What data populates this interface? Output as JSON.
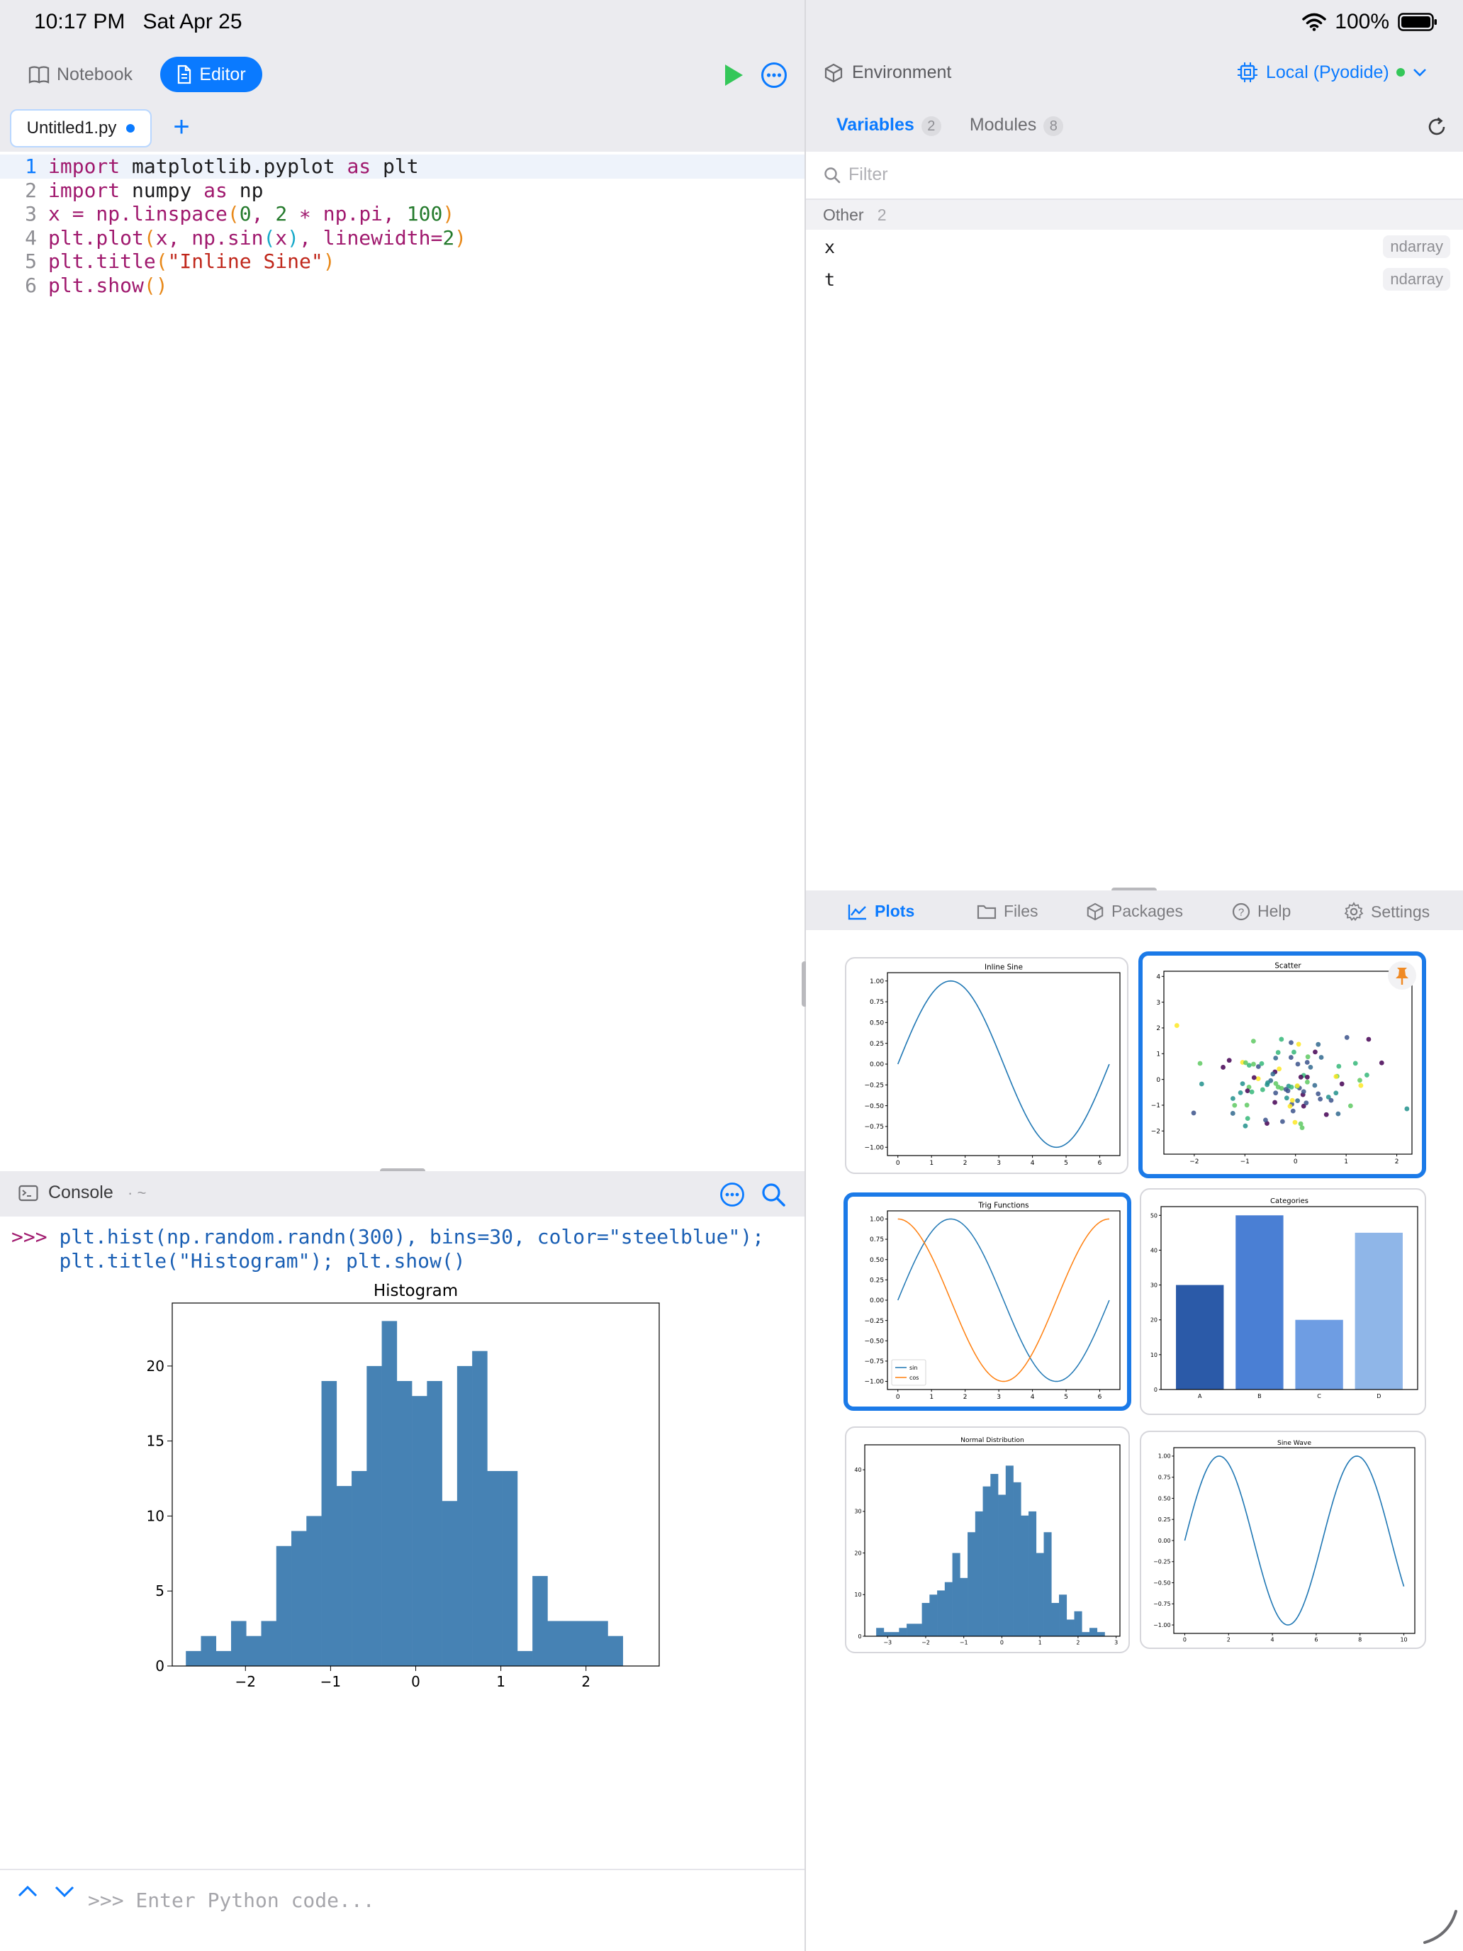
{
  "status": {
    "time": "10:17 PM",
    "date": "Sat Apr 25",
    "battery": "100%"
  },
  "left_toolbar": {
    "notebook_label": "Notebook",
    "editor_label": "Editor"
  },
  "editor": {
    "tab_name": "Untitled1.py",
    "lines": [
      {
        "n": "1",
        "segments": [
          {
            "c": "kw",
            "t": "import"
          },
          {
            "c": "",
            "t": " matplotlib.pyplot "
          },
          {
            "c": "kw",
            "t": "as"
          },
          {
            "c": "",
            "t": " plt"
          }
        ]
      },
      {
        "n": "2",
        "segments": [
          {
            "c": "kw",
            "t": "import"
          },
          {
            "c": "",
            "t": " numpy "
          },
          {
            "c": "kw",
            "t": "as"
          },
          {
            "c": "",
            "t": " np"
          }
        ]
      },
      {
        "n": "3",
        "segments": [
          {
            "c": "kw",
            "t": "x = np.linspace"
          },
          {
            "c": "par",
            "t": "("
          },
          {
            "c": "num",
            "t": "0"
          },
          {
            "c": "kw",
            "t": ", "
          },
          {
            "c": "num",
            "t": "2"
          },
          {
            "c": "kw",
            "t": " ∗ np.pi, "
          },
          {
            "c": "num",
            "t": "100"
          },
          {
            "c": "par",
            "t": ")"
          }
        ]
      },
      {
        "n": "4",
        "segments": [
          {
            "c": "kw",
            "t": "plt.plot"
          },
          {
            "c": "par",
            "t": "("
          },
          {
            "c": "kw",
            "t": "x, np.sin"
          },
          {
            "c": "par2",
            "t": "("
          },
          {
            "c": "kw",
            "t": "x"
          },
          {
            "c": "par2",
            "t": ")"
          },
          {
            "c": "kw",
            "t": ", linewidth="
          },
          {
            "c": "num",
            "t": "2"
          },
          {
            "c": "par",
            "t": ")"
          }
        ]
      },
      {
        "n": "5",
        "segments": [
          {
            "c": "kw",
            "t": "plt.title"
          },
          {
            "c": "par",
            "t": "("
          },
          {
            "c": "str",
            "t": "\"Inline Sine\""
          },
          {
            "c": "par",
            "t": ")"
          }
        ]
      },
      {
        "n": "6",
        "segments": [
          {
            "c": "kw",
            "t": "plt.show"
          },
          {
            "c": "par",
            "t": "()"
          }
        ]
      }
    ]
  },
  "console": {
    "title": "Console",
    "subtitle": "· ~",
    "prompt": ">>>",
    "command_line1": "plt.hist(np.random.randn(300), bins=30, color=\"steelblue\");",
    "command_line2": "plt.title(\"Histogram\"); plt.show()",
    "input_placeholder": ">>> Enter Python code..."
  },
  "environment": {
    "title": "Environment",
    "runtime": "Local (Pyodide)",
    "tabs": [
      {
        "label": "Variables",
        "count": "2"
      },
      {
        "label": "Modules",
        "count": "8"
      }
    ],
    "filter_placeholder": "Filter",
    "group": {
      "label": "Other",
      "count": "2"
    },
    "variables": [
      {
        "name": "x",
        "type": "ndarray"
      },
      {
        "name": "t",
        "type": "ndarray"
      }
    ]
  },
  "bottom_tabs": [
    "Plots",
    "Files",
    "Packages",
    "Help",
    "Settings"
  ],
  "colors": {
    "accent": "#0a7aff",
    "run": "#34c759",
    "steelblue": "#4682b4",
    "mpl_blue": "#1f77b4",
    "mpl_orange": "#ff7f0e"
  },
  "chart_data": [
    {
      "id": "console-histogram",
      "type": "bar",
      "title": "Histogram",
      "bin_edges_start": -2.7,
      "bin_width": 0.177,
      "values": [
        1,
        2,
        1,
        3,
        2,
        3,
        8,
        9,
        10,
        19,
        12,
        13,
        20,
        23,
        19,
        18,
        19,
        11,
        20,
        21,
        13,
        13,
        1,
        6,
        3,
        3,
        3,
        3,
        2
      ],
      "xticks": [
        "−2",
        "−1",
        "0",
        "1",
        "2"
      ],
      "xtick_values": [
        -2,
        -1,
        0,
        1,
        2
      ],
      "yticks": [
        "0",
        "5",
        "10",
        "15",
        "20"
      ],
      "ytick_values": [
        0,
        5,
        10,
        15,
        20
      ],
      "xlim": [
        -2.86,
        2.86
      ],
      "ylim": [
        0,
        24.2
      ]
    },
    {
      "id": "thumb-inline-sine",
      "type": "line",
      "title": "Inline Sine",
      "function": "sin",
      "x_range": [
        0,
        6.283
      ],
      "xticks": [
        "0",
        "1",
        "2",
        "3",
        "4",
        "5",
        "6"
      ],
      "xtick_values": [
        0,
        1,
        2,
        3,
        4,
        5,
        6
      ],
      "yticks": [
        "1.00",
        "0.75",
        "0.50",
        "0.25",
        "0.00",
        "−0.25",
        "−0.50",
        "−0.75",
        "−1.00"
      ],
      "ytick_values": [
        1,
        0.75,
        0.5,
        0.25,
        0,
        -0.25,
        -0.5,
        -0.75,
        -1
      ],
      "xlim": [
        -0.31,
        6.6
      ],
      "ylim": [
        -1.1,
        1.1
      ]
    },
    {
      "id": "thumb-scatter",
      "type": "scatter",
      "title": "Scatter",
      "points": 100,
      "xticks": [
        "−2",
        "−1",
        "0",
        "1",
        "2"
      ],
      "xtick_values": [
        -2,
        -1,
        0,
        1,
        2
      ],
      "yticks": [
        "4",
        "3",
        "2",
        "1",
        "0",
        "−1",
        "−2"
      ],
      "ytick_values": [
        4,
        3,
        2,
        1,
        0,
        -1,
        -2
      ],
      "xlim": [
        -2.6,
        2.3
      ],
      "ylim": [
        -2.9,
        4.2
      ]
    },
    {
      "id": "thumb-trig",
      "type": "line",
      "title": "Trig Functions",
      "series": [
        {
          "name": "sin",
          "function": "sin"
        },
        {
          "name": "cos",
          "function": "cos"
        }
      ],
      "x_range": [
        0,
        6.283
      ],
      "xticks": [
        "0",
        "1",
        "2",
        "3",
        "4",
        "5",
        "6"
      ],
      "xtick_values": [
        0,
        1,
        2,
        3,
        4,
        5,
        6
      ],
      "yticks": [
        "1.00",
        "0.75",
        "0.50",
        "0.25",
        "0.00",
        "−0.25",
        "−0.50",
        "−0.75",
        "−1.00"
      ],
      "ytick_values": [
        1,
        0.75,
        0.5,
        0.25,
        0,
        -0.25,
        -0.5,
        -0.75,
        -1
      ],
      "xlim": [
        -0.31,
        6.6
      ],
      "ylim": [
        -1.1,
        1.1
      ],
      "legend": "lower-left"
    },
    {
      "id": "thumb-categories",
      "type": "bar",
      "title": "Categories",
      "categories": [
        "A",
        "B",
        "C",
        "D"
      ],
      "values": [
        30,
        50,
        20,
        45
      ],
      "bar_colors": [
        "#2b5aa8",
        "#4a7fd4",
        "#6e9de3",
        "#8fb6e8"
      ],
      "yticks": [
        "50",
        "40",
        "30",
        "20",
        "10",
        "0"
      ],
      "ytick_values": [
        50,
        40,
        30,
        20,
        10,
        0
      ],
      "ylim": [
        0,
        52.5
      ]
    },
    {
      "id": "thumb-normal",
      "type": "bar",
      "title": "Normal Distribution",
      "bin_edges_start": -3.3,
      "bin_width": 0.2,
      "values": [
        2,
        1,
        1,
        2,
        3,
        3,
        8,
        10,
        11,
        13,
        20,
        14,
        25,
        30,
        36,
        39,
        34,
        41,
        37,
        29,
        30,
        20,
        25,
        8,
        10,
        4,
        6,
        1,
        2,
        1
      ],
      "xticks": [
        "−3",
        "−2",
        "−1",
        "0",
        "1",
        "2",
        "3"
      ],
      "xtick_values": [
        -3,
        -2,
        -1,
        0,
        1,
        2,
        3
      ],
      "yticks": [
        "40",
        "30",
        "20",
        "10",
        "0"
      ],
      "ytick_values": [
        40,
        30,
        20,
        10,
        0
      ],
      "xlim": [
        -3.6,
        3.1
      ],
      "ylim": [
        0,
        46
      ]
    },
    {
      "id": "thumb-sine-wave",
      "type": "line",
      "title": "Sine Wave",
      "function": "sin",
      "x_range": [
        0,
        10
      ],
      "xticks": [
        "0",
        "2",
        "4",
        "6",
        "8",
        "10"
      ],
      "xtick_values": [
        0,
        2,
        4,
        6,
        8,
        10
      ],
      "yticks": [
        "1.00",
        "0.75",
        "0.50",
        "0.25",
        "0.00",
        "−0.25",
        "−0.50",
        "−0.75",
        "−1.00"
      ],
      "ytick_values": [
        1,
        0.75,
        0.5,
        0.25,
        0,
        -0.25,
        -0.5,
        -0.75,
        -1
      ],
      "xlim": [
        -0.5,
        10.5
      ],
      "ylim": [
        -1.1,
        1.1
      ]
    }
  ]
}
